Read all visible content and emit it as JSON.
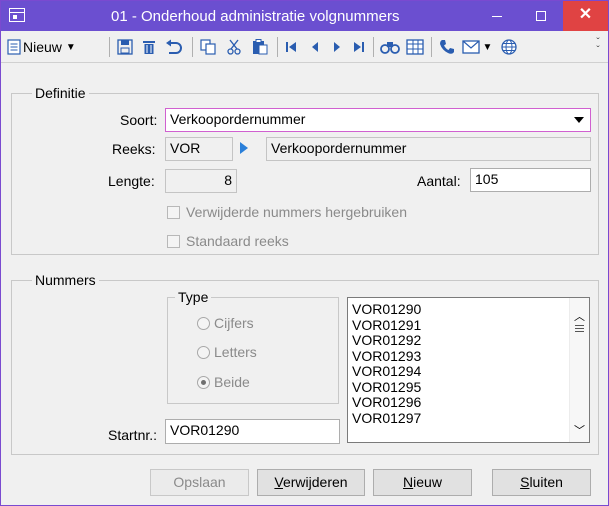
{
  "window": {
    "title": "01 - Onderhoud administratie volgnummers",
    "minimize_icon": "minimize-icon",
    "maximize_icon": "maximize-icon",
    "close_symbol": "✕"
  },
  "toolbar": {
    "new_label": "Nieuw",
    "new_icon": "document-icon",
    "icons": [
      "save-icon",
      "delete-icon",
      "undo-icon",
      "copy-icon",
      "cut-icon",
      "paste-icon",
      "first-icon",
      "previous-icon",
      "next-icon",
      "last-icon",
      "search-icon",
      "grid-icon",
      "phone-icon",
      "mail-icon",
      "globe-icon",
      "overflow-icon"
    ]
  },
  "definitie": {
    "legend": "Definitie",
    "soort_label": "Soort:",
    "soort_value": "Verkoopordernummer",
    "reeks_label": "Reeks:",
    "reeks_code": "VOR",
    "reeks_name": "Verkoopordernummer",
    "lengte_label": "Lengte:",
    "lengte_value": "8",
    "aantal_label": "Aantal:",
    "aantal_value": "105",
    "reuse_label": "Verwijderde nummers hergebruiken",
    "reuse_checked": false,
    "standard_label": "Standaard reeks",
    "standard_checked": false
  },
  "nummers": {
    "legend": "Nummers",
    "type_legend": "Type",
    "type_options": [
      "Cijfers",
      "Letters",
      "Beide"
    ],
    "type_selected": "Beide",
    "startnr_label": "Startnr.:",
    "startnr_value": "VOR01290",
    "list": [
      "VOR01290",
      "VOR01291",
      "VOR01292",
      "VOR01293",
      "VOR01294",
      "VOR01295",
      "VOR01296",
      "VOR01297"
    ]
  },
  "buttons": {
    "save": "Opslaan",
    "delete_underlined": "V",
    "delete_rest": "erwijderen",
    "new_underlined": "N",
    "new_rest": "ieuw",
    "close_underlined": "S",
    "close_rest": "luiten"
  },
  "colors": {
    "titlebar": "#6b4fd0",
    "close_button": "#e04343",
    "combo_focus_border": "#d060d0",
    "toolbar_icon_blue": "#2a5db0"
  }
}
